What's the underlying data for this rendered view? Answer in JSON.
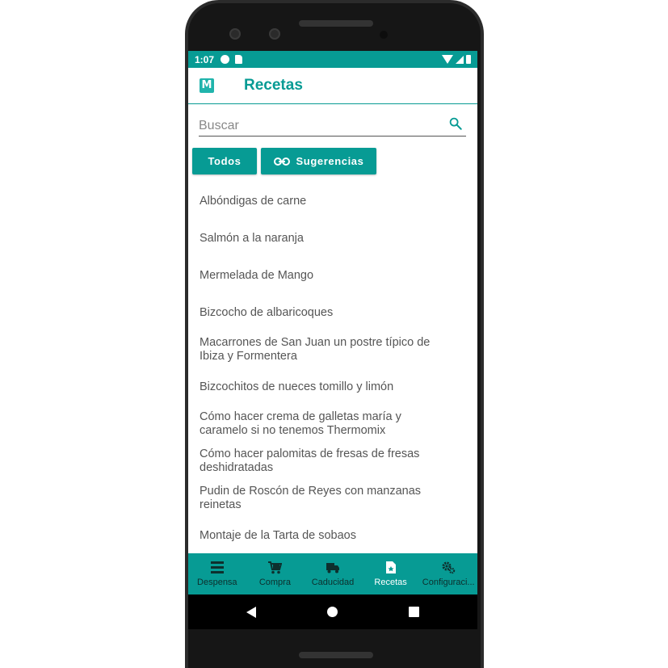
{
  "status_bar": {
    "time": "1:07"
  },
  "app_bar": {
    "logo_text": "M",
    "title": "Recetas"
  },
  "search": {
    "placeholder": "Buscar",
    "value": ""
  },
  "filters": {
    "todos_label": "Todos",
    "sugerencias_label": "Sugerencias"
  },
  "recipes": [
    "Albóndigas de carne",
    "Salmón a la naranja",
    "Mermelada de Mango",
    "Bizcocho de albaricoques",
    "Macarrones de San Juan un postre típico de Ibiza y Formentera",
    "Bizcochitos de nueces tomillo y limón",
    "Cómo hacer crema de galletas maría y caramelo si no tenemos Thermomix",
    "Cómo hacer palomitas de fresas de fresas deshidratadas",
    "Pudin de Roscón de Reyes con manzanas reinetas",
    "Montaje de la Tarta de sobaos"
  ],
  "bottom_nav": [
    {
      "label": "Despensa",
      "icon": "list-icon"
    },
    {
      "label": "Compra",
      "icon": "cart-icon"
    },
    {
      "label": "Caducidad",
      "icon": "truck-icon"
    },
    {
      "label": "Recetas",
      "icon": "recipe-card-icon",
      "active": true
    },
    {
      "label": "Configuraci...",
      "icon": "settings-gears-icon"
    }
  ],
  "colors": {
    "accent": "#079b94",
    "nav_inactive": "#0e2f2d"
  }
}
